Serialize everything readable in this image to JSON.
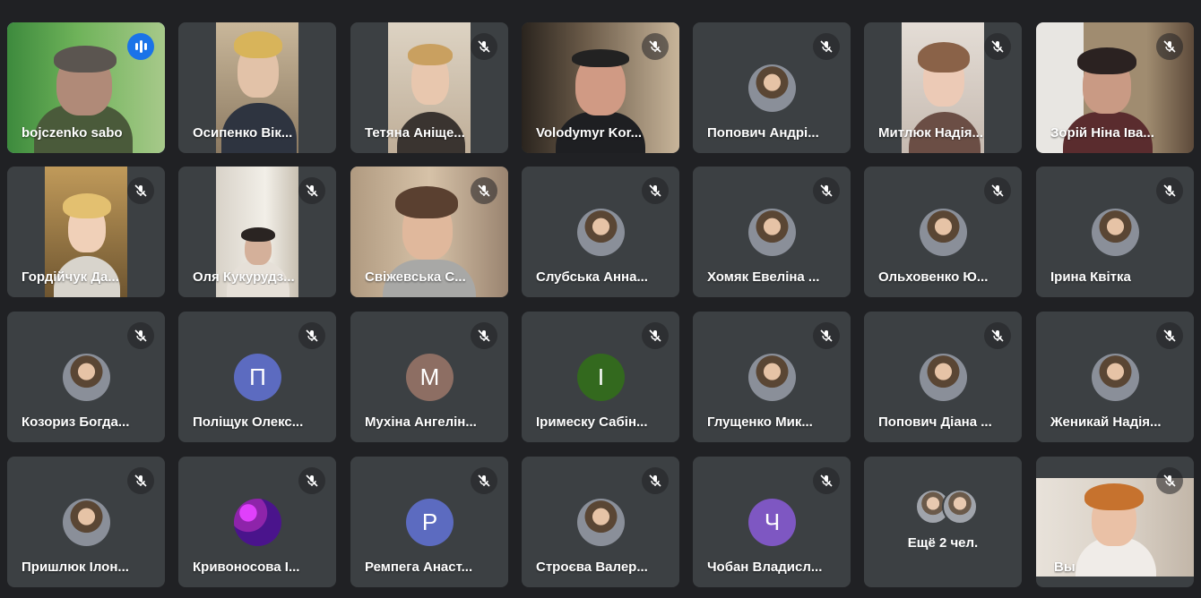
{
  "participants": [
    {
      "name": "bojczenko sabo",
      "speaking": true
    },
    {
      "name": "Осипенко Вік...",
      "muted": false
    },
    {
      "name": "Тетяна Аніще...",
      "muted": true
    },
    {
      "name": "Volodymyr Kor...",
      "muted": true
    },
    {
      "name": "Попович Андрі...",
      "muted": true
    },
    {
      "name": "Митлюк Надія...",
      "muted": true
    },
    {
      "name": "Зорій Ніна Іва...",
      "muted": true
    },
    {
      "name": "Гордійчук Да...",
      "muted": true
    },
    {
      "name": "Оля Кукурудз...",
      "muted": true
    },
    {
      "name": "Свіжевська С...",
      "muted": true
    },
    {
      "name": "Слубська Анна...",
      "muted": true
    },
    {
      "name": "Хомяк Евеліна ...",
      "muted": true
    },
    {
      "name": "Ольховенко Ю...",
      "muted": true
    },
    {
      "name": "Ірина Квітка",
      "muted": true
    },
    {
      "name": "Козориз Богда...",
      "muted": true
    },
    {
      "name": "Поліщук Олекс...",
      "muted": true,
      "initial": "П",
      "color": "#5c6bc0"
    },
    {
      "name": "Мухіна Ангелін...",
      "muted": true,
      "initial": "М",
      "color": "#8d6e63"
    },
    {
      "name": "Іримеску Сабін...",
      "muted": true,
      "initial": "І",
      "color": "#33691e"
    },
    {
      "name": "Глущенко Мик...",
      "muted": true
    },
    {
      "name": "Попович Діана ...",
      "muted": true
    },
    {
      "name": "Женикай Надія...",
      "muted": true
    },
    {
      "name": "Пришлюк Ілон...",
      "muted": true
    },
    {
      "name": "Кривоносова І...",
      "muted": true
    },
    {
      "name": "Ремпега Анаст...",
      "muted": true,
      "initial": "Р",
      "color": "#5c6bc0"
    },
    {
      "name": "Строєва Валер...",
      "muted": true
    },
    {
      "name": "Чобан Владисл...",
      "muted": true,
      "initial": "Ч",
      "color": "#7e57c2"
    }
  ],
  "more": {
    "label": "Ещё 2 чел."
  },
  "self": {
    "name": "Вы",
    "muted": true
  },
  "colors": {
    "background": "#202124",
    "tile": "#3c4043",
    "speaking_border": "#8ab4f8",
    "speaking_badge": "#1a73e8"
  }
}
